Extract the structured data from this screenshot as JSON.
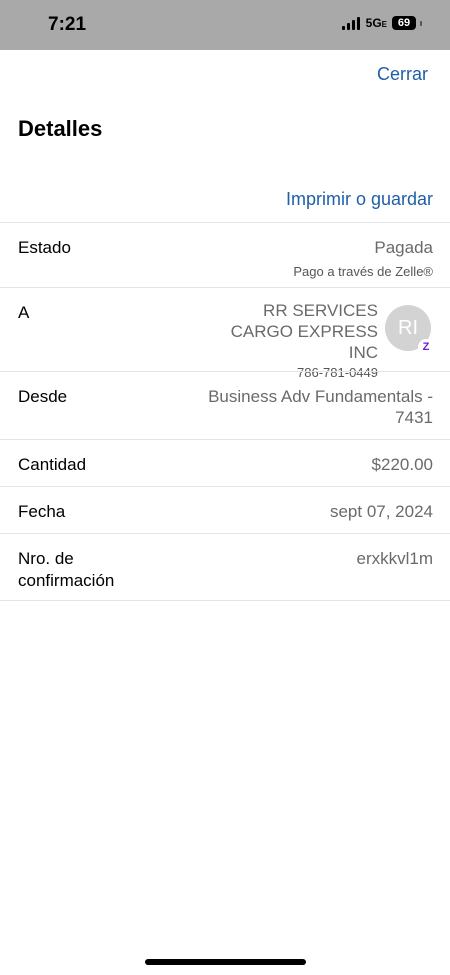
{
  "status_bar": {
    "time": "7:21",
    "network": "5G",
    "network_suffix": "E",
    "battery": "69"
  },
  "header": {
    "close_label": "Cerrar",
    "title": "Detalles",
    "print_label": "Imprimir o guardar"
  },
  "details": {
    "status": {
      "label": "Estado",
      "value": "Pagada",
      "sub": "Pago a través de Zelle®"
    },
    "to": {
      "label": "A",
      "name": "RR SERVICES CARGO EXPRESS INC",
      "phone": "786-781-0449",
      "avatar_initials": "RI",
      "badge": "Z"
    },
    "from": {
      "label": "Desde",
      "value": "Business Adv Fundamentals - 7431"
    },
    "amount": {
      "label": "Cantidad",
      "value": "$220.00"
    },
    "date": {
      "label": "Fecha",
      "value": "sept 07, 2024"
    },
    "confirmation": {
      "label": "Nro. de confirmación",
      "value": "erxkkvl1m"
    }
  },
  "colors": {
    "link": "#1f5fa8",
    "status_bar": "#a9a9a9",
    "zelle": "#6d1ed4"
  }
}
